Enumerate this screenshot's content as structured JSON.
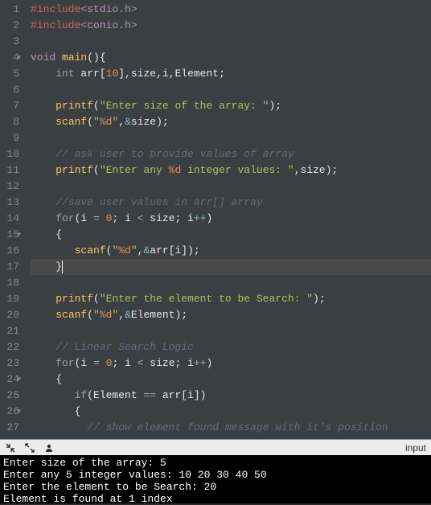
{
  "gutter": {
    "lines": [
      "1",
      "2",
      "3",
      "4",
      "5",
      "6",
      "7",
      "8",
      "9",
      "10",
      "11",
      "12",
      "13",
      "14",
      "15",
      "16",
      "17",
      "18",
      "19",
      "20",
      "21",
      "22",
      "23",
      "24",
      "25",
      "26",
      "27"
    ],
    "fold_lines": [
      4,
      15,
      24,
      26
    ]
  },
  "code": {
    "l1": {
      "preproc": "#include",
      "header": "<stdio.h>"
    },
    "l2": {
      "preproc": "#include",
      "header": "<conio.h>"
    },
    "l4": {
      "type1": "void",
      "func": " main",
      "paren": "(){"
    },
    "l5": {
      "indent": "    ",
      "type": "int",
      "text": " arr[",
      "num": "10",
      "text2": "],size,i,Element;"
    },
    "l7": {
      "indent": "    ",
      "func": "printf",
      "p1": "(",
      "str": "\"Enter size of the array: \"",
      "p2": ");"
    },
    "l8": {
      "indent": "    ",
      "func": "scanf",
      "p1": "(",
      "str1": "\"",
      "fmt": "%d",
      "str2": "\"",
      "rest": ",",
      "op": "&",
      "var": "size);"
    },
    "l10": {
      "indent": "    ",
      "comment": "// ask user to provide values of array"
    },
    "l11": {
      "indent": "    ",
      "func": "printf",
      "p1": "(",
      "str1": "\"Enter any ",
      "fmt": "%d",
      "str2": " integer values: \"",
      "rest": ",size);"
    },
    "l13": {
      "indent": "    ",
      "comment": "//save user values in arr[] array"
    },
    "l14": {
      "indent": "    ",
      "kw": "for",
      "p1": "(i ",
      "op1": "=",
      "sp1": " ",
      "num": "0",
      "semi": "; i ",
      "op2": "<",
      "sp2": " size; i",
      "op3": "++",
      "p2": ")"
    },
    "l15": {
      "indent": "    ",
      "brace": "{"
    },
    "l16": {
      "indent": "       ",
      "func": "scanf",
      "p1": "(",
      "str1": "\"",
      "fmt": "%d",
      "str2": "\"",
      "rest": ",",
      "op": "&",
      "var": "arr[i]);"
    },
    "l17": {
      "indent": "    ",
      "brace": "}"
    },
    "l19": {
      "indent": "    ",
      "func": "printf",
      "p1": "(",
      "str": "\"Enter the element to be Search: \"",
      "p2": ");"
    },
    "l20": {
      "indent": "    ",
      "func": "scanf",
      "p1": "(",
      "str1": "\"",
      "fmt": "%d",
      "str2": "\"",
      "rest": ",",
      "op": "&",
      "var": "Element);"
    },
    "l22": {
      "indent": "    ",
      "comment": "// Linear Search Logic"
    },
    "l23": {
      "indent": "    ",
      "kw": "for",
      "p1": "(i ",
      "op1": "=",
      "sp1": " ",
      "num": "0",
      "semi": "; i ",
      "op2": "<",
      "sp2": " size; i",
      "op3": "++",
      "p2": ")"
    },
    "l24": {
      "indent": "    ",
      "brace": "{"
    },
    "l25": {
      "indent": "       ",
      "kw": "if",
      "p1": "(Element ",
      "op": "==",
      "rest": " arr[i])"
    },
    "l26": {
      "indent": "       ",
      "brace": "{"
    },
    "l27": {
      "indent": "         ",
      "comment": "// show element found message with it's position"
    }
  },
  "toolbar": {
    "input_label": "input"
  },
  "terminal": {
    "l1": "Enter size of the array: 5",
    "l2": "Enter any 5 integer values: 10 20 30 40 50",
    "l3": "Enter the element to be Search: 20",
    "l4": "Element is found at 1 index"
  }
}
